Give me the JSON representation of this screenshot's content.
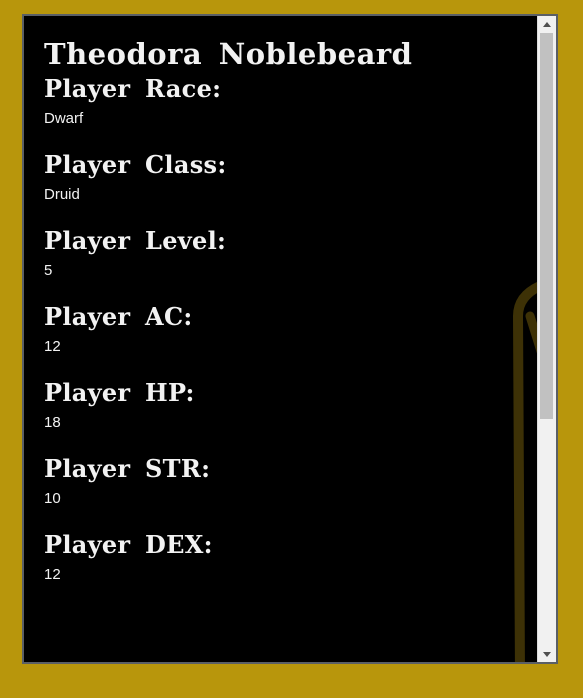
{
  "character": {
    "name": "Theodora Noblebeard"
  },
  "fields": [
    {
      "label": "Player Race:",
      "value": "Dwarf"
    },
    {
      "label": "Player Class:",
      "value": "Druid"
    },
    {
      "label": "Player Level:",
      "value": "5"
    },
    {
      "label": "Player AC:",
      "value": "12"
    },
    {
      "label": "Player HP:",
      "value": "18"
    },
    {
      "label": "Player STR:",
      "value": "10"
    },
    {
      "label": "Player DEX:",
      "value": "12"
    }
  ],
  "scrollbar": {
    "position_fraction": 0.0,
    "visible_fraction": 0.63
  },
  "colors": {
    "page_background": "#b8960c",
    "panel_background": "#000000",
    "text": "#f2f2f2",
    "decoration": "#3a2f05"
  }
}
